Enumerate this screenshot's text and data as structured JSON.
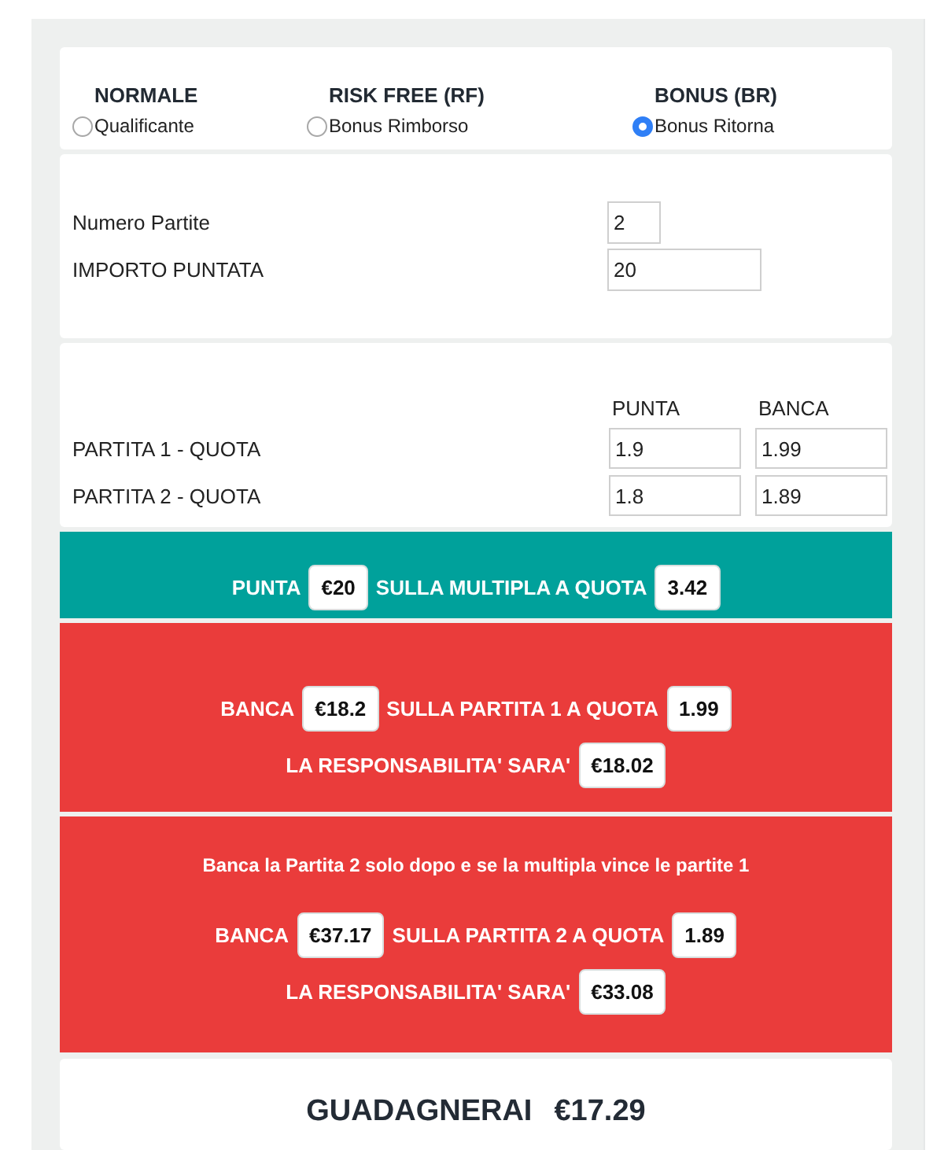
{
  "modes": [
    {
      "heading": "NORMALE",
      "label": "Qualificante",
      "selected": false
    },
    {
      "heading": "RISK FREE (RF)",
      "label": "Bonus Rimborso",
      "selected": false
    },
    {
      "heading": "BONUS (BR)",
      "label": "Bonus Ritorna",
      "selected": true
    }
  ],
  "settings": [
    {
      "label": "Numero Partite",
      "value": "2",
      "kind": "short"
    },
    {
      "label": "IMPORTO PUNTATA",
      "value": "20",
      "kind": "medium"
    }
  ],
  "odds": {
    "columns": [
      "PUNTA",
      "BANCA"
    ],
    "rows": [
      {
        "label": "PARTITA 1 - QUOTA",
        "values": [
          "1.9",
          "1.99"
        ]
      },
      {
        "label": "PARTITA 2 - QUOTA",
        "values": [
          "1.8",
          "1.89"
        ]
      }
    ]
  },
  "results": [
    {
      "kind": "back",
      "lines": [
        [
          {
            "kind": "text",
            "text": "PUNTA"
          },
          {
            "kind": "badge",
            "text": "€20"
          },
          {
            "kind": "text",
            "text": "SULLA MULTIPLA A QUOTA"
          },
          {
            "kind": "badge",
            "text": "3.42"
          }
        ]
      ]
    },
    {
      "kind": "lay",
      "lines": [
        [
          {
            "kind": "text",
            "text": "BANCA"
          },
          {
            "kind": "badge",
            "text": "€18.2"
          },
          {
            "kind": "text",
            "text": "SULLA PARTITA 1 A QUOTA"
          },
          {
            "kind": "badge",
            "text": "1.99"
          }
        ],
        [
          {
            "kind": "text",
            "text": "LA RESPONSABILITA' SARA'"
          },
          {
            "kind": "badge",
            "text": "€18.02"
          }
        ]
      ]
    },
    {
      "kind": "lay",
      "note": "Banca la Partita 2 solo dopo e se la multipla vince le partite 1",
      "lines": [
        [
          {
            "kind": "text",
            "text": "BANCA"
          },
          {
            "kind": "badge",
            "text": "€37.17"
          },
          {
            "kind": "text",
            "text": "SULLA PARTITA 2 A QUOTA"
          },
          {
            "kind": "badge",
            "text": "1.89"
          }
        ],
        [
          {
            "kind": "text",
            "text": "LA RESPONSABILITA' SARA'"
          },
          {
            "kind": "badge",
            "text": "€33.08"
          }
        ]
      ]
    }
  ],
  "profit": {
    "label": "GUADAGNERAI",
    "amount": "€17.29"
  }
}
